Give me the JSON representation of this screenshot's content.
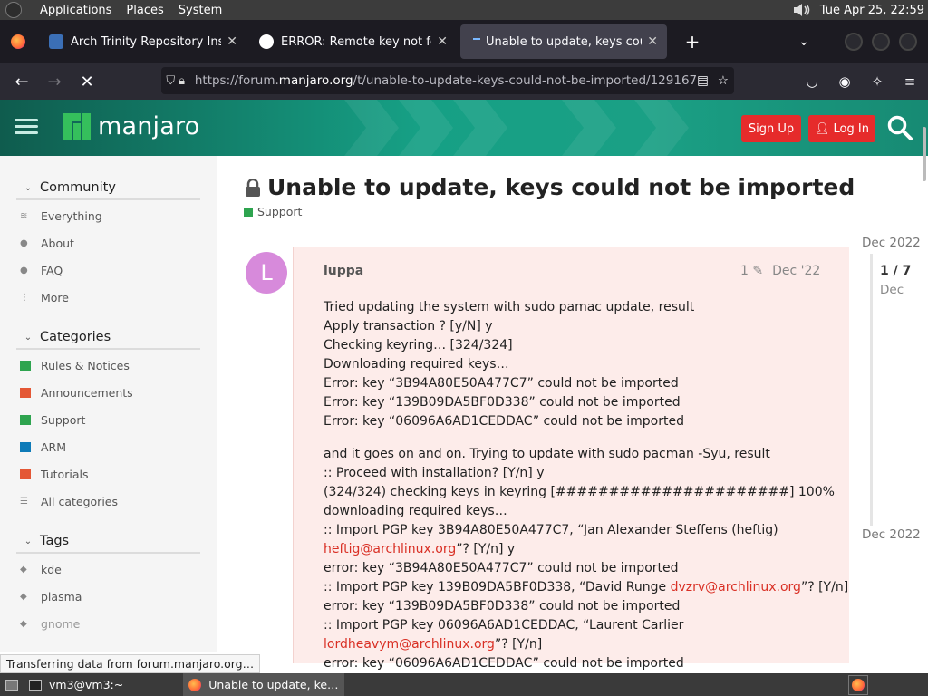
{
  "system_panel": {
    "menus": [
      "Applications",
      "Places",
      "System"
    ],
    "clock": "Tue Apr 25, 22:59"
  },
  "browser": {
    "tabs": [
      {
        "title": "Arch Trinity Repository Insta",
        "favicon": "arch-trinity-icon",
        "active": false
      },
      {
        "title": "ERROR: Remote key not fet",
        "favicon": "github-icon",
        "active": false
      },
      {
        "title": "Unable to update, keys coul",
        "favicon": "loading-icon",
        "active": true
      }
    ],
    "url": {
      "prefix": "https://forum.",
      "domain": "manjaro.org",
      "path": "/t/unable-to-update-keys-could-not-be-imported/129167"
    }
  },
  "site": {
    "brand": "manjaro",
    "sign_up": "Sign Up",
    "log_in": "Log In",
    "brand_color": "#16a085",
    "button_color": "#e62b2b"
  },
  "sidebar": {
    "community": {
      "title": "Community",
      "items": [
        "Everything",
        "About",
        "FAQ",
        "More"
      ]
    },
    "categories": {
      "title": "Categories",
      "items": [
        {
          "label": "Rules & Notices",
          "color": "#2ea44f"
        },
        {
          "label": "Announcements",
          "color": "#e45735"
        },
        {
          "label": "Support",
          "color": "#2ea44f"
        },
        {
          "label": "ARM",
          "color": "#0e7bb8"
        },
        {
          "label": "Tutorials",
          "color": "#e45735"
        },
        {
          "label": "All categories",
          "color": ""
        }
      ]
    },
    "tags": {
      "title": "Tags",
      "items": [
        "kde",
        "plasma",
        "gnome"
      ]
    }
  },
  "topic": {
    "title": "Unable to update, keys could not be imported",
    "category": "Support",
    "post": {
      "avatar_letter": "L",
      "username": "luppa",
      "edits": "1",
      "date": "Dec '22",
      "paragraph1": [
        "Tried updating the system with sudo pamac update, result",
        "Apply transaction ? [y/N] y",
        "Checking keyring… [324/324]",
        "Downloading required keys…",
        "Error: key “3B94A80E50A477C7” could not be imported",
        "Error: key “139B09DA5BF0D338” could not be imported",
        "Error: key “06096A6AD1CEDDAC” could not be imported"
      ],
      "paragraph2": {
        "l1": "and it goes on and on. Trying to update with sudo pacman -Syu, result",
        "l2": ":: Proceed with installation? [Y/n] y",
        "l3": "(324/324) checking keys in keyring [######################] 100%",
        "l4": "downloading required keys…",
        "l5": ":: Import PGP key 3B94A80E50A477C7, “Jan Alexander Steffens (heftig)",
        "l6_link": "heftig@archlinux.org",
        "l6_rest": "”? [Y/n] y",
        "l7": "error: key “3B94A80E50A477C7” could not be imported",
        "l8_pre": ":: Import PGP key 139B09DA5BF0D338, “David Runge ",
        "l8_link": "dvzrv@archlinux.org",
        "l8_rest": "”? [Y/n]",
        "l9": "error: key “139B09DA5BF0D338” could not be imported",
        "l10": ":: Import PGP key 06096A6AD1CEDDAC, “Laurent Carlier",
        "l11_link": "lordheavym@archlinux.org",
        "l11_rest": "”? [Y/n]",
        "l12": "error: key “06096A6AD1CEDDAC” could not be imported"
      }
    },
    "timeline": {
      "top_date": "Dec 2022",
      "position": "1 / 7",
      "position_sub": "Dec",
      "bottom_date": "Dec 2022"
    }
  },
  "status_text": "Transferring data from forum.manjaro.org…",
  "taskbar": {
    "items": [
      "vm3@vm3:~",
      "Unable to update, ke…"
    ]
  }
}
